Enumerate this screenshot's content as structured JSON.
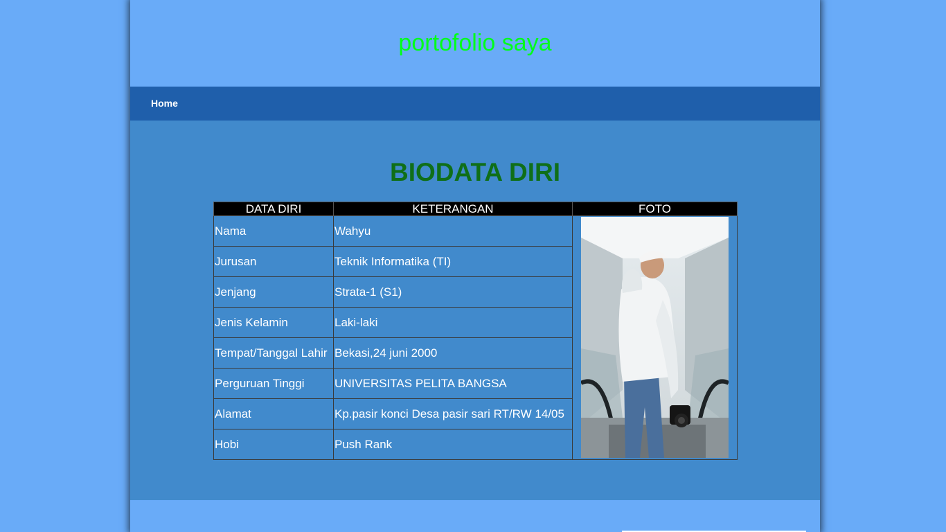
{
  "header": {
    "site_title": "portofolio saya"
  },
  "nav": {
    "home_label": "Home"
  },
  "main": {
    "title": "BIODATA DIRI",
    "table": {
      "columns": [
        "DATA DIRI",
        "KETERANGAN",
        "FOTO"
      ],
      "rows": [
        {
          "field": "Nama",
          "value": "Wahyu"
        },
        {
          "field": "Jurusan",
          "value": "Teknik Informatika (TI)"
        },
        {
          "field": "Jenjang",
          "value": "Strata-1 (S1)"
        },
        {
          "field": "Jenis Kelamin",
          "value": "Laki-laki"
        },
        {
          "field": "Tempat/Tanggal Lahir",
          "value": "Bekasi,24 juni 2000"
        },
        {
          "field": "Perguruan Tinggi",
          "value": "UNIVERSITAS PELITA BANGSA"
        },
        {
          "field": "Alamat",
          "value": "Kp.pasir konci Desa pasir sari RT/RW 14/05"
        },
        {
          "field": "Hobi",
          "value": "Push Rank"
        }
      ]
    }
  },
  "colors": {
    "page_bg": "#69abf8",
    "navbar_bg": "#1f5fab",
    "content_bg": "#418acc",
    "site_title": "#00ff1a",
    "section_title": "#0f6f18",
    "table_header_bg": "#000000"
  }
}
